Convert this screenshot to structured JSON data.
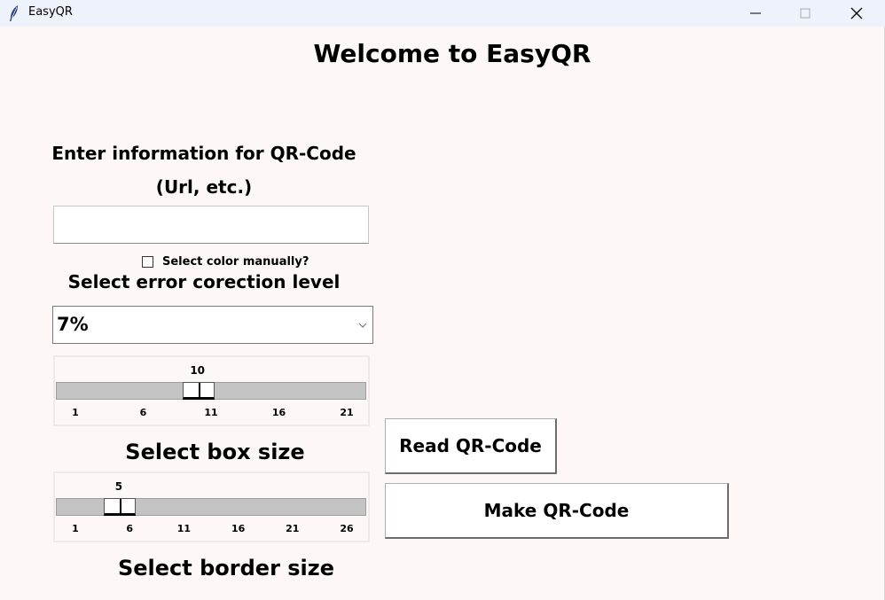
{
  "window": {
    "title": "EasyQR",
    "icon": "feather-icon",
    "controls": [
      "minimize-icon",
      "maximize-icon",
      "close-icon"
    ]
  },
  "main": {
    "welcome": "Welcome to EasyQR",
    "enter_label_line1": "Enter information for QR-Code",
    "enter_label_line2": "(Url, etc.)",
    "info_input": {
      "value": "",
      "placeholder": ""
    },
    "color_checkbox": {
      "label": "Select color manually?",
      "checked": false
    },
    "error_label": "Select error corection level",
    "error_combo": {
      "selected": "7%"
    },
    "box_scale": {
      "value": "10",
      "min": 1,
      "max": 21,
      "ticks": [
        "1",
        "6",
        "11",
        "16",
        "21"
      ]
    },
    "box_label": "Select box size",
    "border_scale": {
      "value": "5",
      "min": 1,
      "max": 26,
      "ticks": [
        "1",
        "6",
        "11",
        "16",
        "21",
        "26"
      ]
    },
    "border_label": "Select border size",
    "read_button": "Read QR-Code",
    "make_button": "Make QR-Code"
  }
}
